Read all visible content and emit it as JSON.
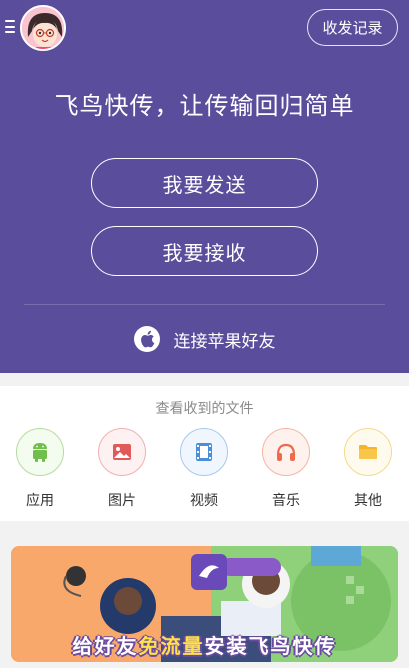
{
  "header": {
    "history_label": "收发记录",
    "slogan": "飞鸟快传，让传输回归简单"
  },
  "actions": {
    "send_label": "我要发送",
    "receive_label": "我要接收",
    "apple_label": "连接苹果好友"
  },
  "files": {
    "title": "查看收到的文件",
    "items": [
      {
        "label": "应用",
        "icon": "android-icon",
        "color": "#6fbf4a"
      },
      {
        "label": "图片",
        "icon": "image-icon",
        "color": "#e05a5a"
      },
      {
        "label": "视频",
        "icon": "film-icon",
        "color": "#4a90d9"
      },
      {
        "label": "音乐",
        "icon": "headphones-icon",
        "color": "#ef6a4a"
      },
      {
        "label": "其他",
        "icon": "folder-icon",
        "color": "#f5b524"
      }
    ]
  },
  "banner": {
    "text_1": "给好友",
    "text_highlight": "免流量",
    "text_2": "安装飞鸟快传"
  },
  "colors": {
    "hero_bg": "#5a4e9c",
    "accent": "#ffffff"
  }
}
